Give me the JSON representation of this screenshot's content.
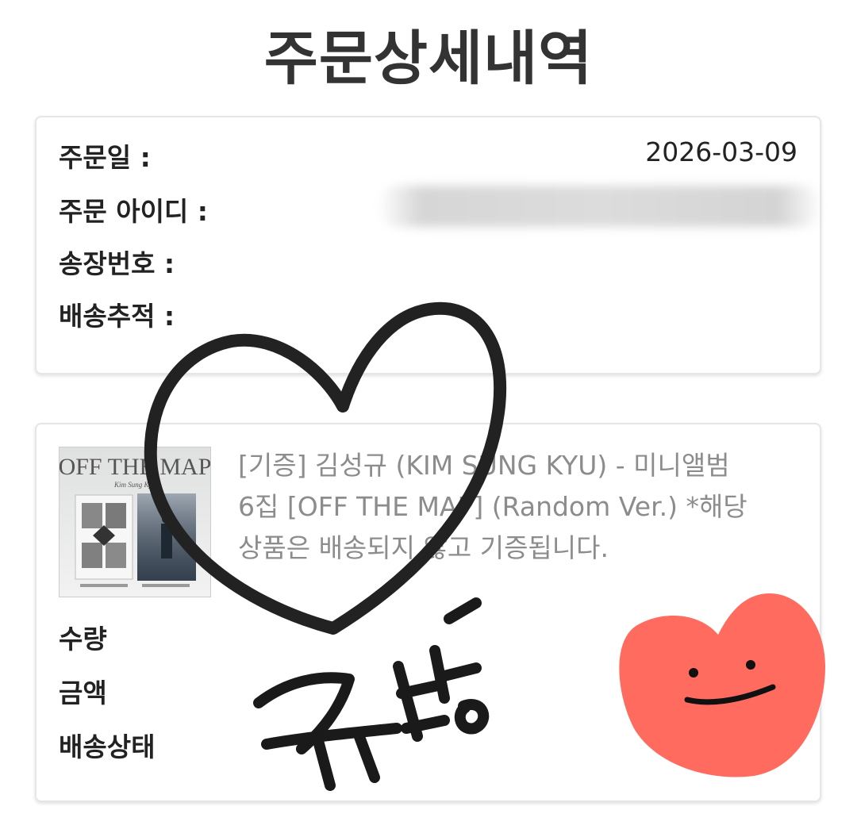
{
  "page": {
    "title": "주문상세내역"
  },
  "order_info": {
    "order_date_label": "주문일 :",
    "order_date_value": "2026-03-09",
    "order_id_label": "주문 아이디 :",
    "invoice_label": "송장번호 :",
    "tracking_label": "배송추적 :"
  },
  "product": {
    "name": "[기증] 김성규 (KIM SUNG KYU) - 미니앨범 6집 [OFF THE MAP] (Random Ver.) *해당 상품은 배송되지 않고 기증됩니다.",
    "name_lines": [
      "[기증] 김성규 (KIM SUNG KYU) - 미니앨범",
      "6집 [OFF THE MAP] (Random Ver.) *해당",
      "상품은 배송되지 않고 기증됩니다."
    ],
    "thumbnail": {
      "title_text": "OFF THE MAP",
      "subtitle_text": "Kim Sung Kyu"
    },
    "quantity_label": "수량",
    "amount_label": "금액",
    "status_label": "배송상태"
  },
  "doodles": {
    "handwritten_text": "규방",
    "heart_outline_color": "#222222",
    "heart_fill_color": "#ff6b5e",
    "face_color": "#111111"
  }
}
